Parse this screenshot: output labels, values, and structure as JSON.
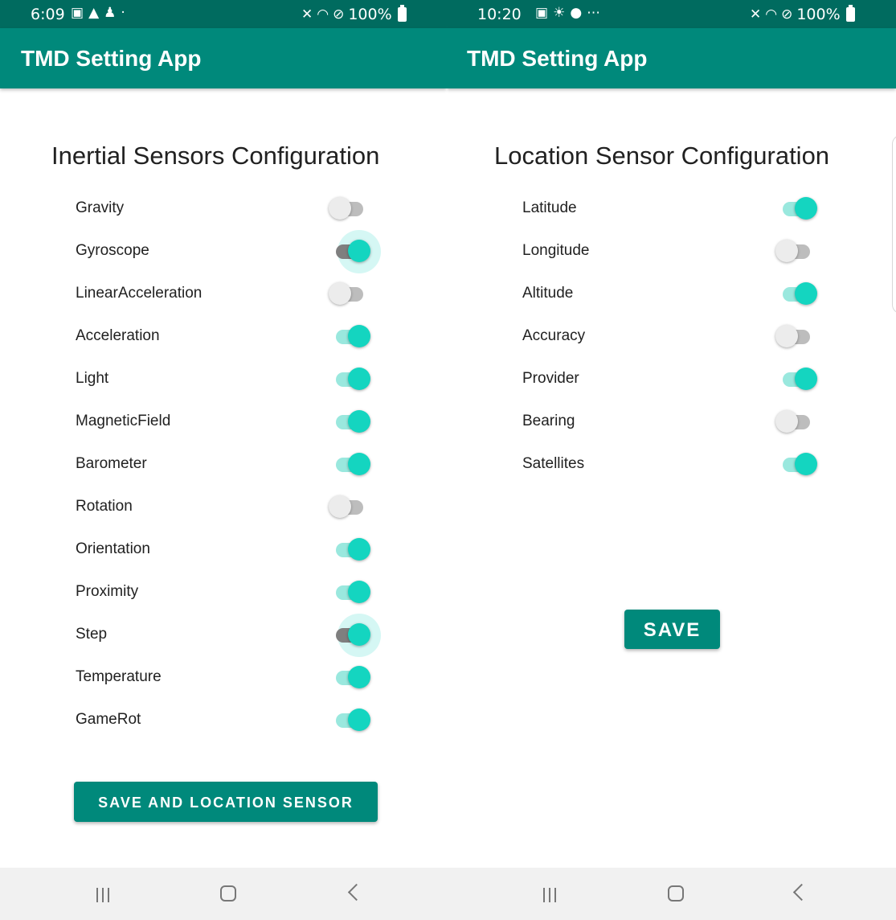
{
  "left": {
    "status": {
      "time": "6:09",
      "icons": [
        "image-icon",
        "warning-icon",
        "person-icon",
        "dot-icon"
      ],
      "battery": "100%"
    },
    "app_title": "TMD Setting App",
    "heading": "Inertial Sensors Configuration",
    "sensors": [
      {
        "label": "Gravity",
        "on": false,
        "focused": false
      },
      {
        "label": "Gyroscope",
        "on": true,
        "focused": true
      },
      {
        "label": "LinearAcceleration",
        "on": false,
        "focused": false
      },
      {
        "label": "Acceleration",
        "on": true,
        "focused": false
      },
      {
        "label": "Light",
        "on": true,
        "focused": false
      },
      {
        "label": "MagneticField",
        "on": true,
        "focused": false
      },
      {
        "label": "Barometer",
        "on": true,
        "focused": false
      },
      {
        "label": "Rotation",
        "on": false,
        "focused": false
      },
      {
        "label": "Orientation",
        "on": true,
        "focused": false
      },
      {
        "label": "Proximity",
        "on": true,
        "focused": false
      },
      {
        "label": "Step",
        "on": true,
        "focused": true
      },
      {
        "label": "Temperature",
        "on": true,
        "focused": false
      },
      {
        "label": "GameRot",
        "on": true,
        "focused": false
      }
    ],
    "button_label": "SAVE AND LOCATION SENSOR"
  },
  "right": {
    "status": {
      "time": "10:20",
      "icons": [
        "image-icon",
        "weather-icon",
        "wear-icon",
        "more-icon"
      ],
      "battery": "100%"
    },
    "app_title": "TMD Setting App",
    "heading": "Location Sensor Configuration",
    "sensors": [
      {
        "label": "Latitude",
        "on": true,
        "focused": false
      },
      {
        "label": "Longitude",
        "on": false,
        "focused": false
      },
      {
        "label": "Altitude",
        "on": true,
        "focused": false
      },
      {
        "label": "Accuracy",
        "on": false,
        "focused": false
      },
      {
        "label": "Provider",
        "on": true,
        "focused": false
      },
      {
        "label": "Bearing",
        "on": false,
        "focused": false
      },
      {
        "label": "Satellites",
        "on": true,
        "focused": false
      }
    ],
    "button_label": "SAVE"
  },
  "colors": {
    "status_bar": "#006b5f",
    "app_bar": "#00897b",
    "switch_on": "#14d5c0",
    "switch_track_on": "#9ae8de",
    "switch_off": "#ececec"
  }
}
